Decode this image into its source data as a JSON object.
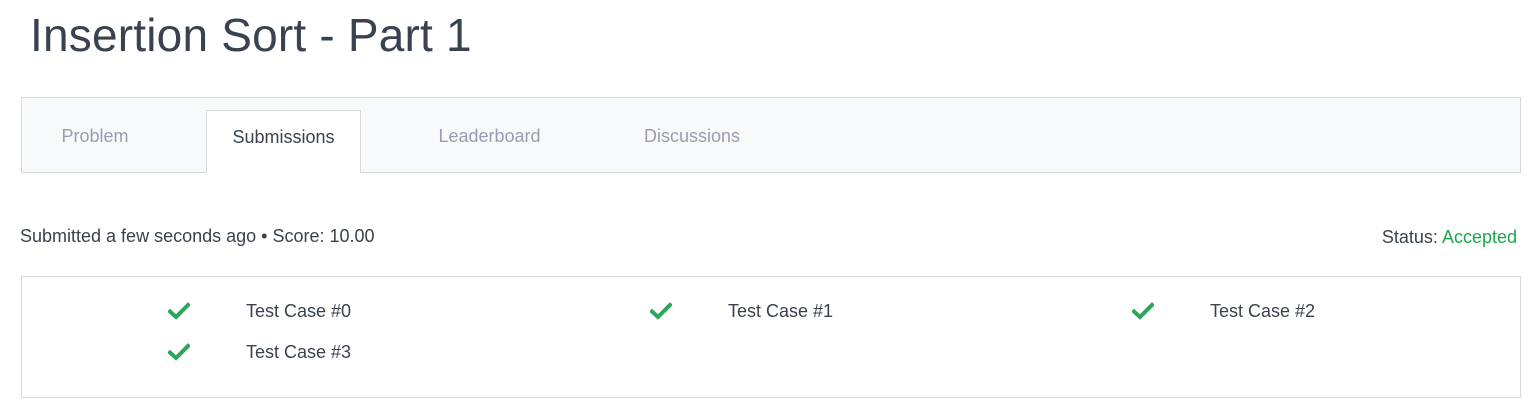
{
  "page": {
    "title": "Insertion Sort - Part 1"
  },
  "tabs": [
    {
      "label": "Problem",
      "active": false
    },
    {
      "label": "Submissions",
      "active": true
    },
    {
      "label": "Leaderboard",
      "active": false
    },
    {
      "label": "Discussions",
      "active": false
    }
  ],
  "submission": {
    "info": "Submitted a few seconds ago • Score: 10.00",
    "status_label": "Status:",
    "status_value": "Accepted"
  },
  "test_cases": [
    {
      "label": "Test Case #0",
      "icon": "check-icon"
    },
    {
      "label": "Test Case #1",
      "icon": "check-icon"
    },
    {
      "label": "Test Case #2",
      "icon": "check-icon"
    },
    {
      "label": "Test Case #3",
      "icon": "check-icon"
    }
  ],
  "colors": {
    "accent_green": "#1ba94c",
    "check_green": "#2ea55c",
    "text": "#39424e",
    "muted": "#979faf"
  }
}
